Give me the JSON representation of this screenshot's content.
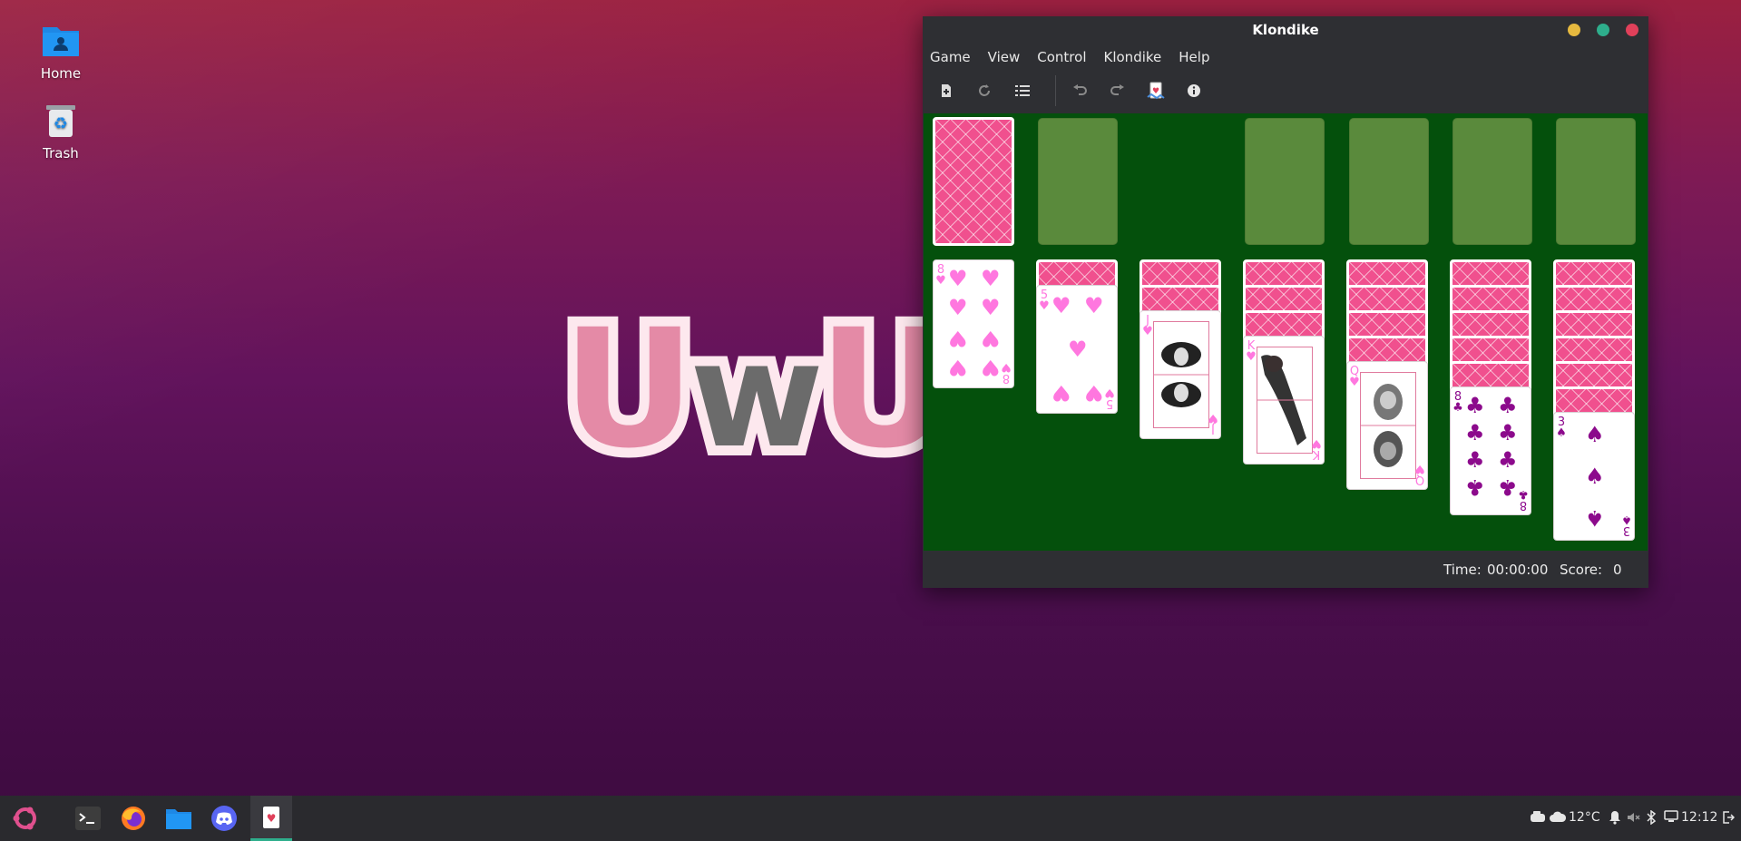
{
  "desktop": {
    "icons": [
      {
        "label": "Home",
        "icon": "home-folder-icon"
      },
      {
        "label": "Trash",
        "icon": "trash-icon"
      }
    ],
    "wallpaper_text": {
      "u1": "U",
      "w": "w",
      "u2": "U"
    }
  },
  "window": {
    "title": "Klondike",
    "menu": [
      "Game",
      "View",
      "Control",
      "Klondike",
      "Help"
    ],
    "toolbar": [
      "new-game-icon",
      "restart-icon",
      "select-game-icon",
      "undo-icon",
      "redo-icon",
      "hint-icon",
      "info-icon"
    ],
    "status": {
      "time_label": "Time:",
      "time_value": "00:00:00",
      "score_label": "Score:",
      "score_value": "0"
    },
    "colors": {
      "felt": "#04500c",
      "slot": "#5a8a3c",
      "card_back": "#f0508e",
      "red_suit": "#ff77df",
      "black_suit": "#8c0a8c"
    }
  },
  "game": {
    "stock": "face-down",
    "waste": "empty",
    "foundations": [
      "empty",
      "empty",
      "empty",
      "empty"
    ],
    "tableau": [
      {
        "face_down": 0,
        "top": {
          "rank": "8",
          "suit": "♥"
        }
      },
      {
        "face_down": 1,
        "top": {
          "rank": "5",
          "suit": "♥"
        }
      },
      {
        "face_down": 2,
        "top": {
          "rank": "J",
          "suit": "♥"
        }
      },
      {
        "face_down": 3,
        "top": {
          "rank": "K",
          "suit": "♥"
        }
      },
      {
        "face_down": 4,
        "top": {
          "rank": "Q",
          "suit": "♥"
        }
      },
      {
        "face_down": 5,
        "top": {
          "rank": "8",
          "suit": "♣"
        }
      },
      {
        "face_down": 6,
        "top": {
          "rank": "3",
          "suit": "♠"
        }
      }
    ]
  },
  "taskbar": {
    "apps": [
      "app-menu-icon",
      "terminal-icon",
      "firefox-icon",
      "files-icon",
      "discord-icon",
      "solitaire-icon"
    ],
    "tray": {
      "temperature": "12°C",
      "clock": "12:12"
    }
  }
}
